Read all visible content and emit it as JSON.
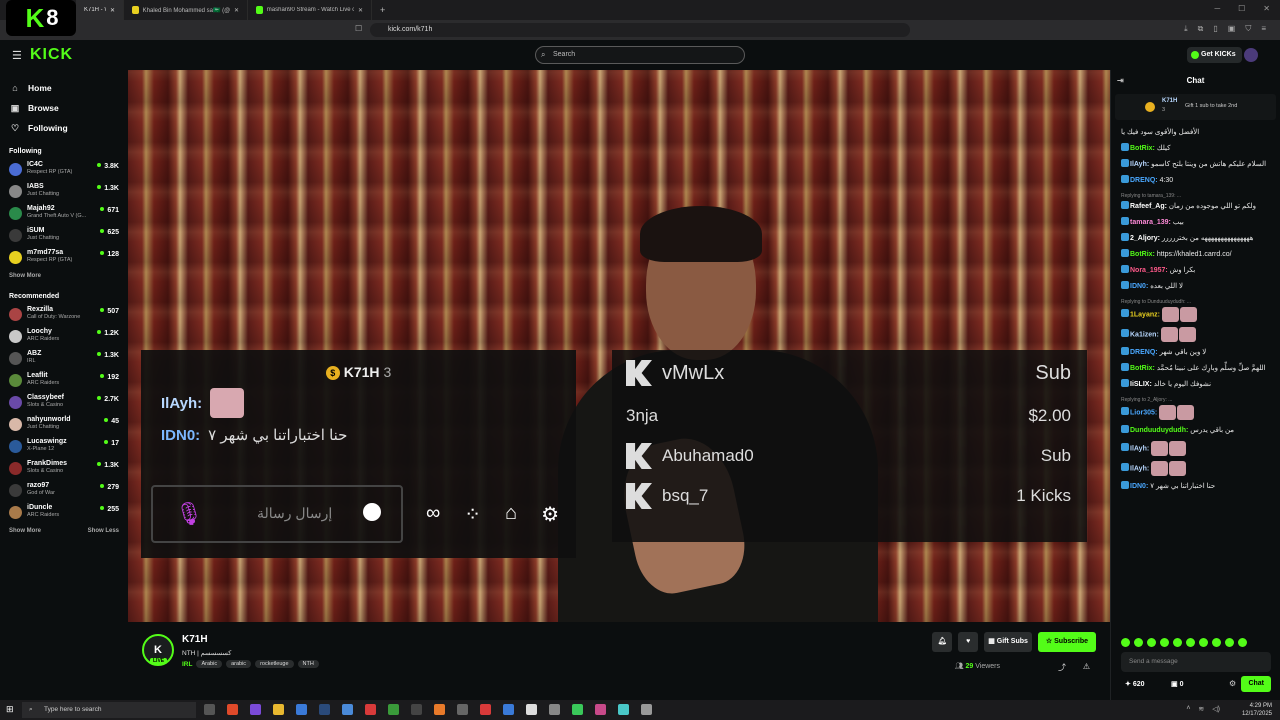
{
  "browser": {
    "tabs": [
      {
        "label": "K71H - Watch Live on Kick",
        "active": true
      },
      {
        "label": "Khaled Bin Mohammed sa🇸🇦 (@j7zm...",
        "active": false
      },
      {
        "label": "mashari90 Stream - Watch Live on K...",
        "active": false
      }
    ],
    "new_tab": "+",
    "url": "kick.com/k71h",
    "logo_text": "K",
    "logo_num": "8"
  },
  "header": {
    "logo": "KICK",
    "search_placeholder": "Search",
    "get_kicks": "Get KICKs"
  },
  "sidebar": {
    "nav": [
      {
        "label": "Home",
        "icon": "home-icon"
      },
      {
        "label": "Browse",
        "icon": "browse-icon"
      },
      {
        "label": "Following",
        "icon": "heart-icon"
      }
    ],
    "following_title": "Following",
    "following": [
      {
        "name": "IC4C",
        "game": "Respect RP (GTA)",
        "viewers": "3.8K",
        "color": "#4a6cd4"
      },
      {
        "name": "IABS",
        "game": "Just Chatting",
        "viewers": "1.3K",
        "color": "#888888"
      },
      {
        "name": "Majah92",
        "game": "Grand Theft Auto V (G...",
        "viewers": "671",
        "color": "#2a8a4a"
      },
      {
        "name": "iSUM",
        "game": "Just Chatting",
        "viewers": "625",
        "color": "#3a3a3a"
      },
      {
        "name": "m7md77sa",
        "game": "Respect RP (GTA)",
        "viewers": "128",
        "color": "#e8d020"
      }
    ],
    "show_more_following": "Show More",
    "recommended_title": "Recommended",
    "recommended": [
      {
        "name": "Rexzilla",
        "game": "Call of Duty: Warzone",
        "viewers": "507",
        "color": "#aa4444"
      },
      {
        "name": "Loochy",
        "game": "ARC Raiders",
        "viewers": "1.2K",
        "color": "#c8c8c8"
      },
      {
        "name": "ABZ",
        "game": "IRL",
        "viewers": "1.3K",
        "color": "#555555"
      },
      {
        "name": "Leaflit",
        "game": "ARC Raiders",
        "viewers": "192",
        "color": "#5a8a3a"
      },
      {
        "name": "Classybeef",
        "game": "Slots & Casino",
        "viewers": "2.7K",
        "color": "#6a4aa8"
      },
      {
        "name": "nahyunworld",
        "game": "Just Chatting",
        "viewers": "45",
        "color": "#d8b8a8"
      },
      {
        "name": "Lucaswingz",
        "game": "X-Plane 12",
        "viewers": "17",
        "color": "#2a5a9a"
      },
      {
        "name": "FrankDimes",
        "game": "Slots & Casino",
        "viewers": "1.3K",
        "color": "#8a2a2a"
      },
      {
        "name": "razo97",
        "game": "God of War",
        "viewers": "279",
        "color": "#3a3a3a"
      },
      {
        "name": "iDuncle",
        "game": "ARC Raiders",
        "viewers": "255",
        "color": "#a87a4a"
      }
    ],
    "show_more": "Show More",
    "show_less": "Show Less"
  },
  "overlay": {
    "top_name": "K71H",
    "top_count": "3",
    "lines": [
      {
        "user": "IlAyh:",
        "text": ""
      },
      {
        "user": "IDN0:",
        "text": "حنا اختباراتنا بي شهر ٧"
      }
    ],
    "input_placeholder": "إرسال رسالة",
    "subs": [
      {
        "name": "vMwLx",
        "amount": "Sub",
        "icon": true
      },
      {
        "name": "3nja",
        "amount": "$2.00",
        "icon": false
      },
      {
        "name": "Abuhamad0",
        "amount": "Sub",
        "icon": true
      },
      {
        "name": "bsq_7",
        "amount": "1 Kicks",
        "icon": true
      }
    ]
  },
  "channel": {
    "avatar_letter": "K",
    "live": "LIVE",
    "name": "K71H",
    "title": "NTH | كسسسسم",
    "category": "IRL",
    "tags": [
      "Arabic",
      "arabic",
      "rocketleuge",
      "NTH"
    ],
    "gift_subs": "Gift Subs",
    "subscribe": "Subscribe",
    "viewers_count": "29",
    "viewers_label": "Viewers"
  },
  "chat": {
    "title": "Chat",
    "pinned_name": "K71H",
    "pinned_count": "3",
    "pinned_text": "Gift 1 sub to take 2nd",
    "messages": [
      {
        "user": "",
        "color": "#ffffff",
        "text": "الأفضل والأقوى سود فيك يا",
        "reply": ""
      },
      {
        "user": "BotRix:",
        "color": "#53fc18",
        "text": "كيلك",
        "reply": ""
      },
      {
        "user": "IlAyh:",
        "color": "#b8d8ff",
        "text": "السلام عليكم هاتش من وينتا بلتح كاسمو",
        "reply": ""
      },
      {
        "user": "DRENQ:",
        "color": "#4aa8ff",
        "text": "4:30",
        "reply": ""
      },
      {
        "user": "Rafeef_Ag:",
        "color": "#ffffff",
        "text": "ولكم تو اللي موجوده من زمان",
        "reply": "Replying to tamara_139: ..."
      },
      {
        "user": "tamara_139:",
        "color": "#ff8ad8",
        "text": "بيب",
        "reply": ""
      },
      {
        "user": "2_Aljory:",
        "color": "#ffffff",
        "text": "هههههههههههههههه من بختررررر",
        "reply": ""
      },
      {
        "user": "BotRix:",
        "color": "#53fc18",
        "text": "https://khaled1.carrd.co/",
        "reply": ""
      },
      {
        "user": "Nora_1957:",
        "color": "#ff5a8a",
        "text": "بكرا وش",
        "reply": ""
      },
      {
        "user": "IDN0:",
        "color": "#4aa8ff",
        "text": "لا اللي بعده",
        "reply": ""
      },
      {
        "user": "1Layanz:",
        "color": "#e8d020",
        "text": "",
        "reply": "Replying to Dunduuduydudh: ..."
      },
      {
        "user": "Ka1izen:",
        "color": "#b8d8ff",
        "text": "",
        "reply": ""
      },
      {
        "user": "DRENQ:",
        "color": "#4aa8ff",
        "text": "لا وين باقي شهر",
        "reply": ""
      },
      {
        "user": "BotRix:",
        "color": "#53fc18",
        "text": "اللهمَّ صلِّ وسلِّم وبارِك على نبينا مُحمَّد",
        "reply": ""
      },
      {
        "user": "IiSLIX:",
        "color": "#ffffff",
        "text": "نشوفك اليوم يا خالد",
        "reply": ""
      },
      {
        "user": "Lior305:",
        "color": "#4aa8ff",
        "text": "",
        "reply": "Replying to 2_Aljory: ..."
      },
      {
        "user": "Dunduuduydudh:",
        "color": "#53fc18",
        "text": "من باقي يدرس",
        "reply": ""
      },
      {
        "user": "IlAyh:",
        "color": "#b8d8ff",
        "text": "",
        "reply": ""
      },
      {
        "user": "IlAyh:",
        "color": "#b8d8ff",
        "text": "",
        "reply": ""
      },
      {
        "user": "IDN0:",
        "color": "#4aa8ff",
        "text": "حنا اختباراتنا بي شهر ٧",
        "reply": ""
      }
    ],
    "input_placeholder": "Send a message",
    "points": "620",
    "kicks": "0",
    "send_label": "Chat"
  },
  "taskbar": {
    "search_placeholder": "Type here to search",
    "time": "4:29 PM",
    "date": "12/17/2025"
  },
  "colors": {
    "kick_green": "#53fc18",
    "background": "#0b0e0f"
  }
}
